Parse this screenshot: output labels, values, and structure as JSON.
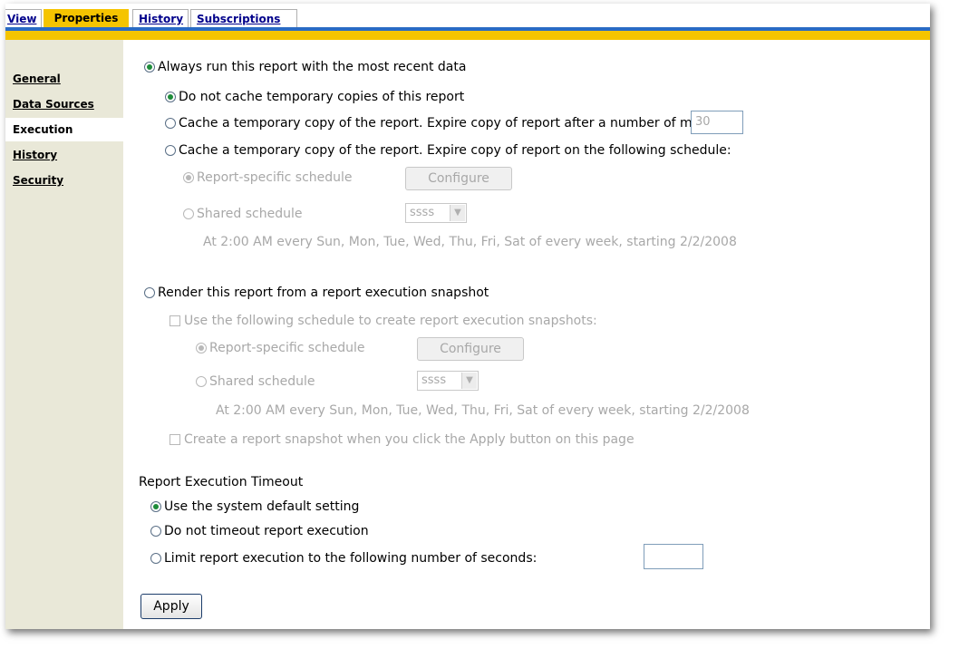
{
  "tabs": {
    "view": "View",
    "properties": "Properties",
    "history": "History",
    "subscriptions": "Subscriptions"
  },
  "nav": {
    "items": [
      "General",
      "Data Sources",
      "Execution",
      "History",
      "Security"
    ],
    "active": "Execution"
  },
  "execution": {
    "always_run": "Always run this report with the most recent data",
    "no_cache": "Do not cache temporary copies of this report",
    "cache_minutes": "Cache a temporary copy of the report. Expire copy of report after a number of minutes:",
    "cache_minutes_value": "30",
    "cache_schedule": "Cache a temporary copy of the report. Expire copy of report on the following schedule:",
    "report_specific_schedule": "Report-specific schedule",
    "configure": "Configure",
    "shared_schedule": "Shared schedule",
    "shared_schedule_selected": "ssss",
    "schedule_desc": "At 2:00 AM every Sun, Mon, Tue, Wed, Thu, Fri, Sat of every week, starting 2/2/2008",
    "render_snapshot": "Render this report from a report execution snapshot",
    "use_schedule_snapshots": "Use the following schedule to create report execution snapshots:",
    "snapshot_report_specific": "Report-specific schedule",
    "snapshot_configure": "Configure",
    "snapshot_shared": "Shared schedule",
    "snapshot_shared_selected": "ssss",
    "snapshot_schedule_desc": "At 2:00 AM every Sun, Mon, Tue, Wed, Thu, Fri, Sat of every week, starting 2/2/2008",
    "create_snapshot_on_apply": "Create a report snapshot when you click the Apply button on this page"
  },
  "timeout": {
    "heading": "Report Execution Timeout",
    "system_default": "Use the system default setting",
    "no_timeout": "Do not timeout report execution",
    "limit_seconds": "Limit report execution to the following number of seconds:",
    "limit_seconds_value": ""
  },
  "apply_label": "Apply",
  "colors": {
    "tab_active": "#f5c400",
    "blue_bar": "#2a6bc4",
    "nav_bg": "#e9e8d8",
    "radio_selected": "#1e8c3a"
  }
}
